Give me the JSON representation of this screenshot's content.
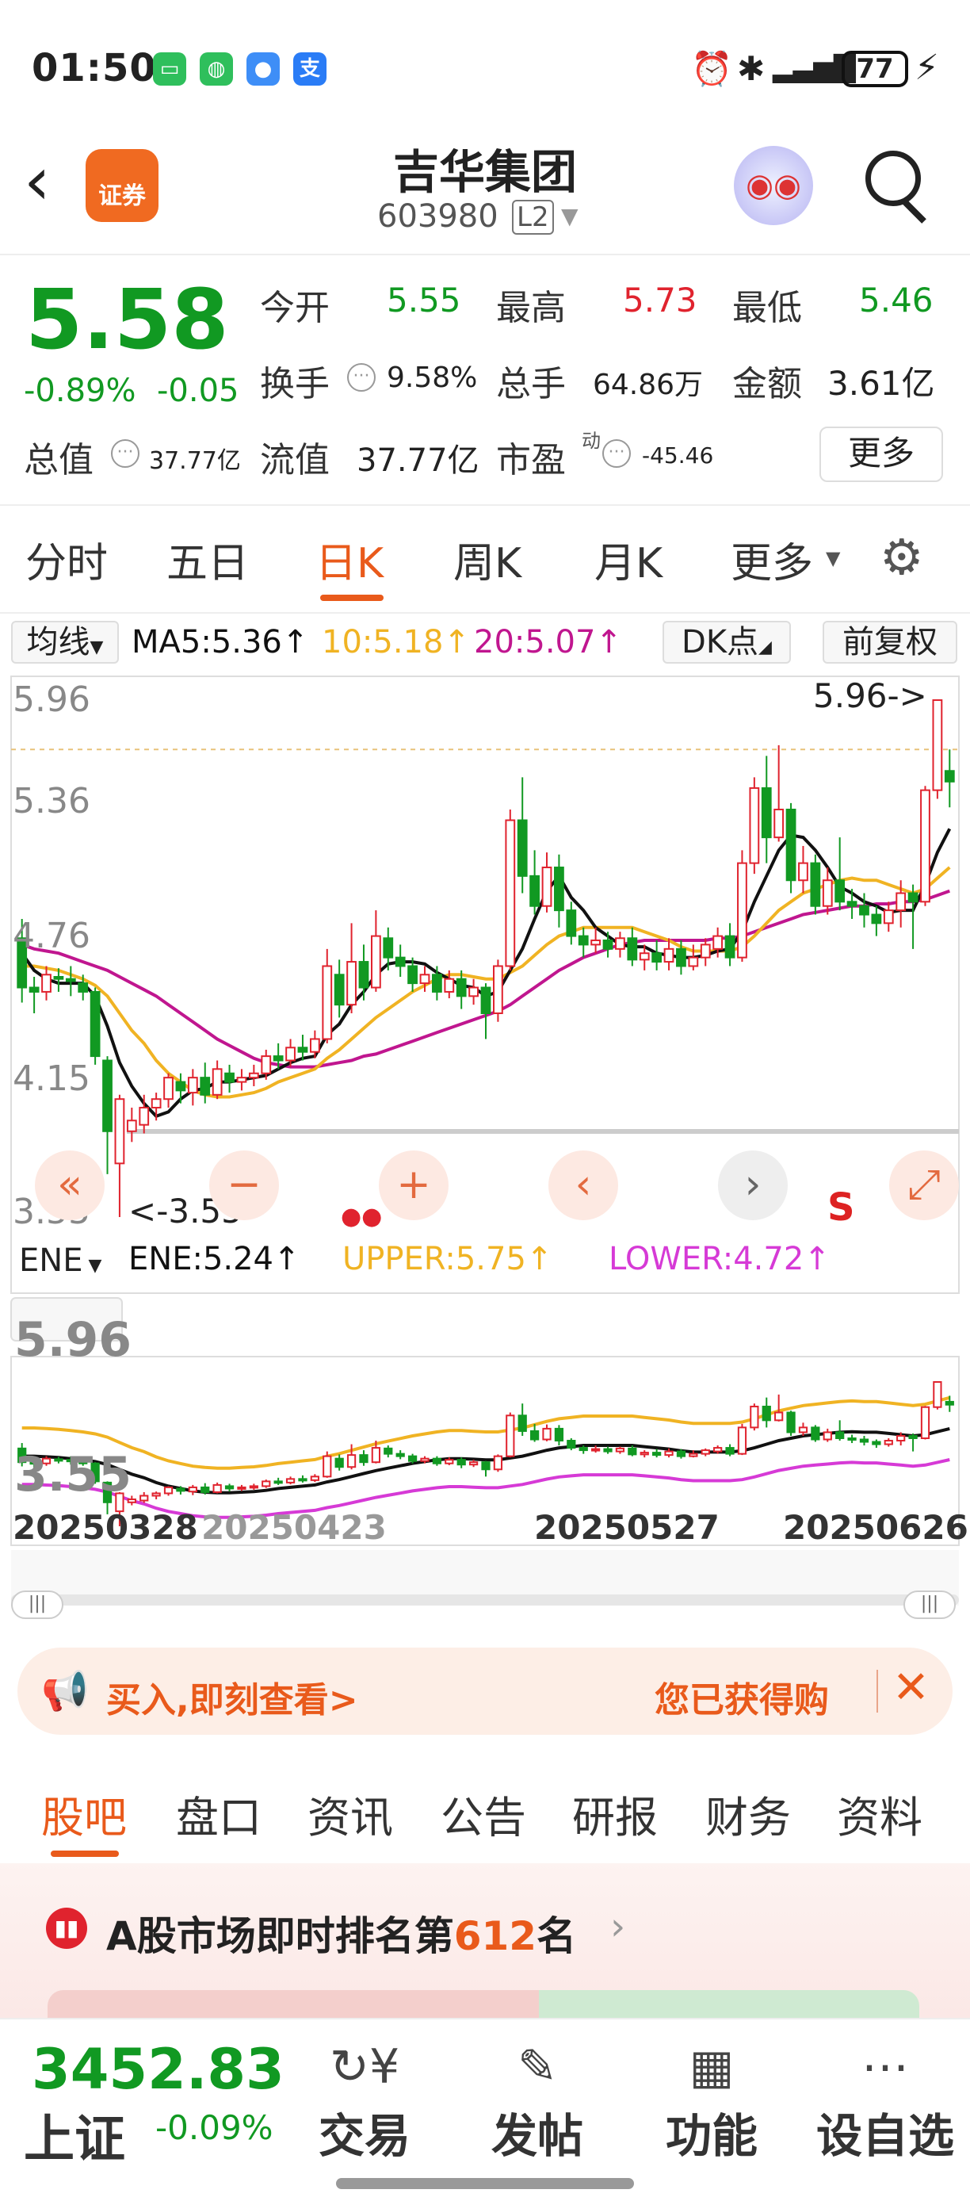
{
  "status_bar": {
    "time": "01:50",
    "battery": "77"
  },
  "header": {
    "logo_label": "证券",
    "title": "吉华集团",
    "code": "603980",
    "level_badge": "L2"
  },
  "quote": {
    "price": "5.58",
    "change_pct": "-0.89%",
    "change_amt": "-0.05",
    "open_label": "今开",
    "open": "5.55",
    "high_label": "最高",
    "high": "5.73",
    "low_label": "最低",
    "low": "5.46",
    "turnover_label": "换手",
    "turnover": "9.58%",
    "volume_label": "总手",
    "volume": "64.86万",
    "amount_label": "金额",
    "amount": "3.61亿",
    "mktcap_label": "总值",
    "mktcap": "37.77亿",
    "float_label": "流值",
    "float_cap": "37.77亿",
    "pe_label": "市盈",
    "pe_sup": "动",
    "pe": "-45.46",
    "more_label": "更多"
  },
  "tabs": [
    "分时",
    "五日",
    "日K",
    "周K",
    "月K",
    "更多"
  ],
  "active_tab": "日K",
  "indicators": {
    "ma_select": "均线",
    "ma5": "MA5:5.36↑",
    "ma10": "10:5.18↑",
    "ma20": "20:5.07↑",
    "dk_select": "DK点",
    "adjust": "前复权",
    "ene_select": "ENE",
    "ene": "ENE:5.24↑",
    "upper": "UPPER:5.75↑",
    "lower": "LOWER:4.72↑"
  },
  "chart_data": {
    "type": "candlestick",
    "y_ticks": [
      "5.96",
      "5.36",
      "4.76",
      "4.15",
      "3.55"
    ],
    "ylim": [
      3.55,
      5.96
    ],
    "max_marker": "5.96->",
    "min_marker": "<-3.55",
    "sub_y_ticks": [
      "5.96",
      "3.55"
    ],
    "x_dates": [
      "20250328",
      "20250423",
      "20250527",
      "20250626"
    ],
    "candles": [
      [
        4.85,
        4.62,
        4.94,
        4.55
      ],
      [
        4.62,
        4.6,
        4.67,
        4.5
      ],
      [
        4.6,
        4.68,
        4.72,
        4.56
      ],
      [
        4.67,
        4.66,
        4.71,
        4.6
      ],
      [
        4.66,
        4.65,
        4.72,
        4.58
      ],
      [
        4.64,
        4.6,
        4.68,
        4.56
      ],
      [
        4.6,
        4.3,
        4.62,
        4.26
      ],
      [
        4.28,
        3.95,
        4.3,
        3.75
      ],
      [
        3.8,
        4.1,
        4.12,
        3.55
      ],
      [
        3.95,
        4.0,
        4.06,
        3.9
      ],
      [
        3.98,
        4.06,
        4.12,
        3.94
      ],
      [
        4.06,
        4.1,
        4.13,
        4.0
      ],
      [
        4.1,
        4.2,
        4.22,
        4.06
      ],
      [
        4.18,
        4.14,
        4.22,
        4.08
      ],
      [
        4.13,
        4.2,
        4.24,
        4.07
      ],
      [
        4.2,
        4.12,
        4.27,
        4.08
      ],
      [
        4.12,
        4.24,
        4.28,
        4.1
      ],
      [
        4.22,
        4.18,
        4.26,
        4.13
      ],
      [
        4.18,
        4.2,
        4.24,
        4.14
      ],
      [
        4.2,
        4.22,
        4.26,
        4.16
      ],
      [
        4.22,
        4.3,
        4.33,
        4.19
      ],
      [
        4.3,
        4.28,
        4.36,
        4.24
      ],
      [
        4.28,
        4.34,
        4.38,
        4.25
      ],
      [
        4.34,
        4.32,
        4.4,
        4.28
      ],
      [
        4.32,
        4.38,
        4.42,
        4.29
      ],
      [
        4.38,
        4.72,
        4.8,
        4.36
      ],
      [
        4.68,
        4.54,
        4.75,
        4.48
      ],
      [
        4.54,
        4.74,
        4.92,
        4.5
      ],
      [
        4.74,
        4.62,
        4.82,
        4.56
      ],
      [
        4.62,
        4.86,
        4.98,
        4.6
      ],
      [
        4.85,
        4.76,
        4.9,
        4.7
      ],
      [
        4.76,
        4.72,
        4.82,
        4.67
      ],
      [
        4.72,
        4.64,
        4.76,
        4.6
      ],
      [
        4.64,
        4.68,
        4.72,
        4.6
      ],
      [
        4.68,
        4.6,
        4.72,
        4.56
      ],
      [
        4.6,
        4.66,
        4.7,
        4.57
      ],
      [
        4.66,
        4.58,
        4.7,
        4.52
      ],
      [
        4.58,
        4.62,
        4.66,
        4.54
      ],
      [
        4.62,
        4.5,
        4.64,
        4.38
      ],
      [
        4.5,
        4.72,
        4.75,
        4.46
      ],
      [
        4.72,
        5.4,
        5.45,
        4.7
      ],
      [
        5.4,
        5.14,
        5.6,
        5.06
      ],
      [
        5.14,
        5.0,
        5.26,
        4.96
      ],
      [
        5.0,
        5.18,
        5.25,
        4.97
      ],
      [
        5.18,
        4.98,
        5.24,
        4.9
      ],
      [
        4.98,
        4.86,
        5.02,
        4.82
      ],
      [
        4.86,
        4.82,
        4.9,
        4.76
      ],
      [
        4.82,
        4.84,
        4.9,
        4.78
      ],
      [
        4.84,
        4.8,
        4.88,
        4.76
      ],
      [
        4.8,
        4.85,
        4.88,
        4.76
      ],
      [
        4.85,
        4.75,
        4.9,
        4.72
      ],
      [
        4.75,
        4.78,
        4.82,
        4.7
      ],
      [
        4.78,
        4.74,
        4.84,
        4.7
      ],
      [
        4.74,
        4.8,
        4.85,
        4.7
      ],
      [
        4.8,
        4.72,
        4.84,
        4.68
      ],
      [
        4.72,
        4.76,
        4.82,
        4.7
      ],
      [
        4.76,
        4.82,
        4.85,
        4.72
      ],
      [
        4.8,
        4.86,
        4.9,
        4.76
      ],
      [
        4.86,
        4.76,
        4.92,
        4.72
      ],
      [
        4.76,
        5.2,
        5.26,
        4.74
      ],
      [
        5.2,
        5.55,
        5.6,
        5.15
      ],
      [
        5.55,
        5.32,
        5.7,
        5.2
      ],
      [
        5.32,
        5.45,
        5.75,
        5.3
      ],
      [
        5.45,
        5.12,
        5.48,
        5.06
      ],
      [
        5.12,
        5.2,
        5.28,
        5.06
      ],
      [
        5.2,
        5.0,
        5.24,
        4.96
      ],
      [
        5.0,
        5.12,
        5.18,
        4.96
      ],
      [
        5.12,
        5.02,
        5.32,
        4.98
      ],
      [
        5.02,
        5.0,
        5.08,
        4.94
      ],
      [
        5.0,
        4.96,
        5.06,
        4.9
      ],
      [
        4.96,
        4.92,
        5.0,
        4.86
      ],
      [
        4.92,
        4.98,
        5.02,
        4.88
      ],
      [
        4.98,
        5.06,
        5.12,
        4.9
      ],
      [
        5.06,
        5.02,
        5.1,
        4.8
      ],
      [
        5.02,
        5.54,
        5.56,
        5.0
      ],
      [
        5.54,
        5.96,
        5.96,
        5.5
      ],
      [
        5.63,
        5.58,
        5.73,
        5.46
      ]
    ],
    "ma5": [
      4.78,
      4.7,
      4.66,
      4.64,
      4.64,
      4.64,
      4.58,
      4.44,
      4.27,
      4.16,
      4.08,
      4.02,
      4.04,
      4.1,
      4.14,
      4.15,
      4.18,
      4.18,
      4.19,
      4.2,
      4.21,
      4.24,
      4.27,
      4.29,
      4.3,
      4.4,
      4.45,
      4.54,
      4.6,
      4.68,
      4.73,
      4.74,
      4.74,
      4.73,
      4.69,
      4.66,
      4.63,
      4.62,
      4.58,
      4.6,
      4.7,
      4.8,
      4.94,
      5.07,
      5.14,
      5.04,
      4.98,
      4.9,
      4.86,
      4.82,
      4.81,
      4.81,
      4.78,
      4.77,
      4.76,
      4.76,
      4.77,
      4.79,
      4.8,
      4.88,
      5.02,
      5.14,
      5.26,
      5.33,
      5.32,
      5.26,
      5.18,
      5.09,
      5.06,
      5.02,
      5.0,
      4.97,
      4.98,
      4.98,
      5.1,
      5.25,
      5.36
    ],
    "ma10": [
      4.72,
      4.72,
      4.71,
      4.7,
      4.68,
      4.66,
      4.63,
      4.58,
      4.5,
      4.42,
      4.36,
      4.28,
      4.22,
      4.18,
      4.14,
      4.12,
      4.11,
      4.11,
      4.12,
      4.13,
      4.15,
      4.18,
      4.2,
      4.22,
      4.24,
      4.29,
      4.33,
      4.38,
      4.43,
      4.48,
      4.52,
      4.56,
      4.6,
      4.63,
      4.66,
      4.68,
      4.68,
      4.67,
      4.66,
      4.66,
      4.69,
      4.72,
      4.77,
      4.82,
      4.86,
      4.88,
      4.9,
      4.9,
      4.9,
      4.9,
      4.9,
      4.88,
      4.86,
      4.84,
      4.81,
      4.79,
      4.79,
      4.79,
      4.79,
      4.81,
      4.86,
      4.92,
      4.98,
      5.02,
      5.06,
      5.08,
      5.1,
      5.12,
      5.13,
      5.12,
      5.12,
      5.1,
      5.08,
      5.06,
      5.08,
      5.13,
      5.18
    ],
    "ma20": [
      4.82,
      4.8,
      4.79,
      4.78,
      4.76,
      4.74,
      4.72,
      4.7,
      4.67,
      4.64,
      4.61,
      4.58,
      4.54,
      4.5,
      4.46,
      4.42,
      4.38,
      4.35,
      4.32,
      4.29,
      4.27,
      4.26,
      4.25,
      4.25,
      4.25,
      4.26,
      4.27,
      4.28,
      4.3,
      4.31,
      4.33,
      4.35,
      4.37,
      4.39,
      4.41,
      4.43,
      4.45,
      4.47,
      4.49,
      4.51,
      4.54,
      4.58,
      4.62,
      4.66,
      4.7,
      4.73,
      4.76,
      4.78,
      4.8,
      4.82,
      4.83,
      4.84,
      4.84,
      4.84,
      4.84,
      4.84,
      4.84,
      4.85,
      4.85,
      4.86,
      4.88,
      4.9,
      4.92,
      4.94,
      4.96,
      4.97,
      4.98,
      4.99,
      5.0,
      5.0,
      5.01,
      5.01,
      5.02,
      5.02,
      5.03,
      5.05,
      5.07
    ]
  },
  "controls": {
    "rewind": "«",
    "zoom_out": "−",
    "zoom_in": "+",
    "prev": "‹",
    "next": "›",
    "s_mark": "S",
    "expand": "⤢"
  },
  "banner": {
    "left_text": "买入,即刻查看>",
    "right_text": "您已获得购"
  },
  "bottom_tabs": [
    "股吧",
    "盘口",
    "资讯",
    "公告",
    "研报",
    "财务",
    "资料"
  ],
  "active_bottom_tab": "股吧",
  "rank": {
    "prefix": "A股市场即时排名第",
    "number": "612",
    "suffix": "名"
  },
  "footer": {
    "index_value": "3452.83",
    "index_name": "上证",
    "index_change": "-0.09%",
    "items": [
      "交易",
      "发帖",
      "功能",
      "设自选"
    ]
  },
  "colors": {
    "up": "#e0232e",
    "down": "#119922",
    "accent": "#e95a1b",
    "ma5": "#111111",
    "ma10": "#f0b323",
    "ma20": "#c0168f",
    "lower": "#d63ad6"
  }
}
